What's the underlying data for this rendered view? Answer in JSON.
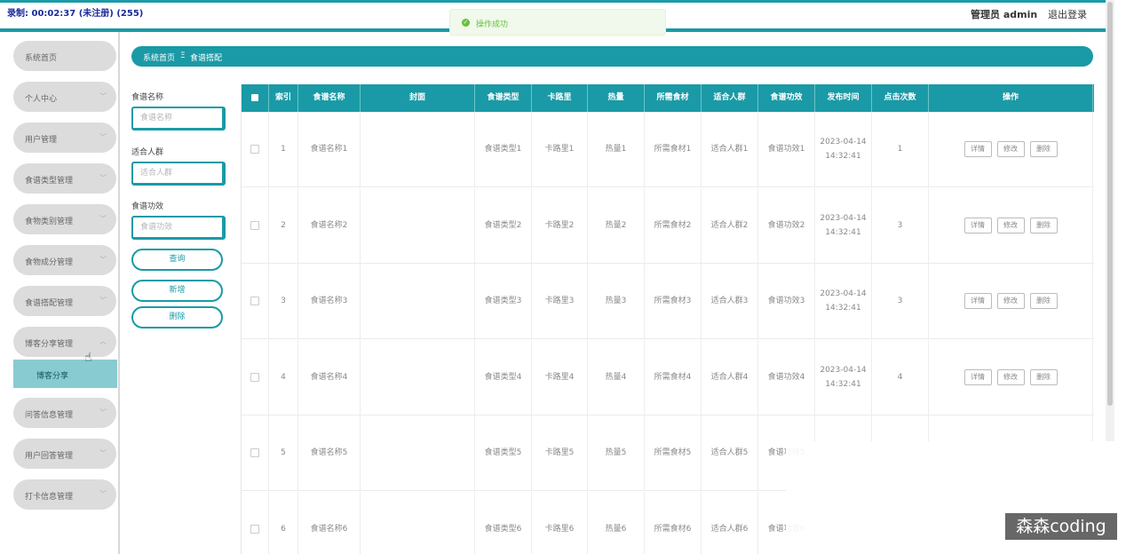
{
  "recording": "录制: 00:02:37 (未注册) (255)",
  "header": {
    "admin_label": "管理员 admin",
    "logout_label": "退出登录"
  },
  "toast": {
    "message": "操作成功"
  },
  "sidebar": {
    "items": [
      {
        "label": "系统首页",
        "chevron": false
      },
      {
        "label": "个人中心",
        "chevron": true
      },
      {
        "label": "用户管理",
        "chevron": true
      },
      {
        "label": "食谱类型管理",
        "chevron": true
      },
      {
        "label": "食物类别管理",
        "chevron": true
      },
      {
        "label": "食物成分管理",
        "chevron": true
      },
      {
        "label": "食谱搭配管理",
        "chevron": true
      },
      {
        "label": "博客分享管理",
        "chevron": true,
        "expanded": true
      },
      {
        "label": "问答信息管理",
        "chevron": true
      },
      {
        "label": "用户回答管理",
        "chevron": true
      },
      {
        "label": "打卡信息管理",
        "chevron": true
      }
    ],
    "submenu": {
      "label": "博客分享"
    }
  },
  "breadcrumb": {
    "home": "系统首页",
    "separator": "Ξ",
    "current": "食谱搭配"
  },
  "filters": {
    "name_label": "食谱名称",
    "name_placeholder": "食谱名称",
    "crowd_label": "适合人群",
    "crowd_placeholder": "适合人群",
    "effect_label": "食谱功效",
    "effect_placeholder": "食谱功效",
    "query_button": "查询",
    "add_button": "新增",
    "delete_button": "删除"
  },
  "table": {
    "headers": [
      "索引",
      "食谱名称",
      "封面",
      "食谱类型",
      "卡路里",
      "热量",
      "所需食材",
      "适合人群",
      "食谱功效",
      "发布时间",
      "点击次数",
      "操作"
    ],
    "actions": {
      "detail": "详情",
      "edit": "修改",
      "delete": "删除"
    },
    "rows": [
      {
        "index": "1",
        "name": "食谱名称1",
        "cover": "",
        "type": "食谱类型1",
        "calorie": "卡路里1",
        "heat": "热量1",
        "ingredients": "所需食材1",
        "crowd": "适合人群1",
        "effect": "食谱功效1",
        "date": "2023-04-14",
        "time": "14:32:41",
        "clicks": "1"
      },
      {
        "index": "2",
        "name": "食谱名称2",
        "cover": "",
        "type": "食谱类型2",
        "calorie": "卡路里2",
        "heat": "热量2",
        "ingredients": "所需食材2",
        "crowd": "适合人群2",
        "effect": "食谱功效2",
        "date": "2023-04-14",
        "time": "14:32:41",
        "clicks": "3"
      },
      {
        "index": "3",
        "name": "食谱名称3",
        "cover": "",
        "type": "食谱类型3",
        "calorie": "卡路里3",
        "heat": "热量3",
        "ingredients": "所需食材3",
        "crowd": "适合人群3",
        "effect": "食谱功效3",
        "date": "2023-04-14",
        "time": "14:32:41",
        "clicks": "3"
      },
      {
        "index": "4",
        "name": "食谱名称4",
        "cover": "",
        "type": "食谱类型4",
        "calorie": "卡路里4",
        "heat": "热量4",
        "ingredients": "所需食材4",
        "crowd": "适合人群4",
        "effect": "食谱功效4",
        "date": "2023-04-14",
        "time": "14:32:41",
        "clicks": "4"
      },
      {
        "index": "5",
        "name": "食谱名称5",
        "cover": "",
        "type": "食谱类型5",
        "calorie": "卡路里5",
        "heat": "热量5",
        "ingredients": "所需食材5",
        "crowd": "适合人群5",
        "effect": "食谱功效5",
        "date": "",
        "time": "",
        "clicks": ""
      },
      {
        "index": "6",
        "name": "食谱名称6",
        "cover": "",
        "type": "食谱类型6",
        "calorie": "卡路里6",
        "heat": "热量6",
        "ingredients": "所需食材6",
        "crowd": "适合人群6",
        "effect": "食谱功效6",
        "date": "",
        "time": "",
        "clicks": ""
      }
    ]
  },
  "watermark": "森森coding",
  "colors": {
    "accent": "#1a9aa6",
    "submenu_active": "#88cbd1",
    "toast_text": "#67c23a"
  }
}
